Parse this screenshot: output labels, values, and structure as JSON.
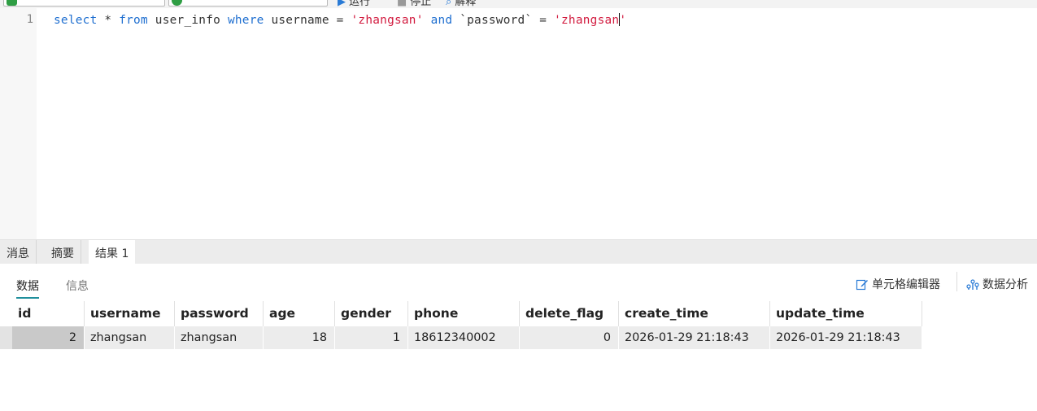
{
  "toolbar": {
    "run_label": "运行",
    "stop_label": "停止",
    "explain_label": "解释"
  },
  "editor": {
    "line_number": "1",
    "sql": {
      "t1": "select",
      "t2": " * ",
      "t3": "from",
      "t4": " user_info ",
      "t5": "where",
      "t6": " username = ",
      "t7": "'zhangsan'",
      "t8": " ",
      "t9": "and",
      "t10": " `password` = ",
      "t11": "'zhangsan",
      "t12": "'"
    }
  },
  "result_tabs": [
    "消息",
    "摘要",
    "结果 1"
  ],
  "sub_tabs": [
    "数据",
    "信息"
  ],
  "actions": {
    "cell_editor": "单元格编辑器",
    "data_analysis": "数据分析"
  },
  "table": {
    "columns": [
      "id",
      "username",
      "password",
      "age",
      "gender",
      "phone",
      "delete_flag",
      "create_time",
      "update_time"
    ],
    "rows": [
      [
        "2",
        "zhangsan",
        "zhangsan",
        "18",
        "1",
        "18612340002",
        "0",
        "2026-01-29 21:18:43",
        "2026-01-29 21:18:43"
      ]
    ]
  },
  "colors": {
    "keyword": "#1f6fd0",
    "string": "#d21b3f",
    "accent": "#1f8f9c"
  }
}
